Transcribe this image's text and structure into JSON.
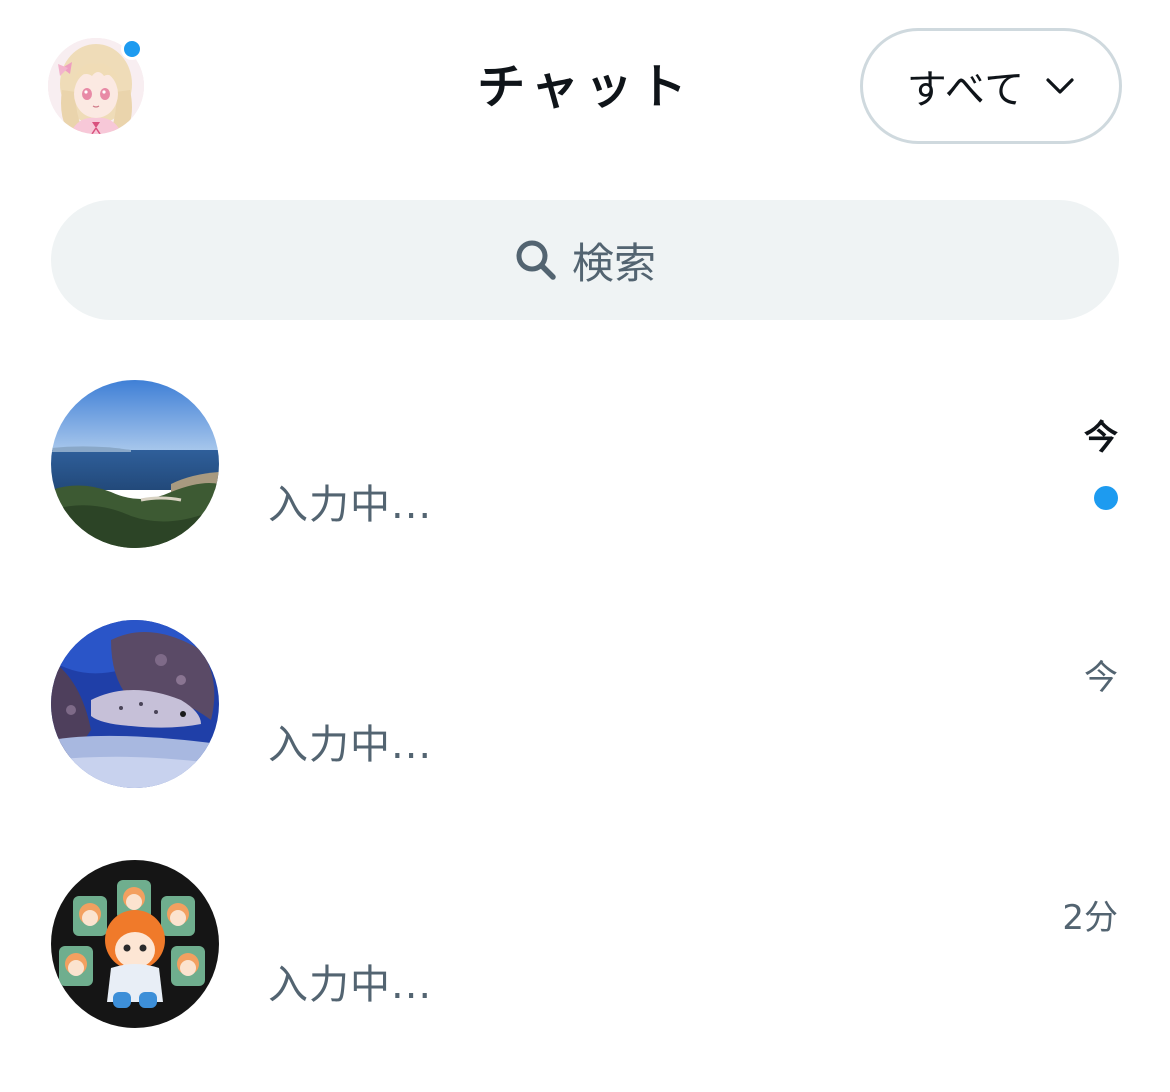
{
  "header": {
    "title": "チャット",
    "filter_label": "すべて",
    "profile_avatar": "anime-girl-avatar",
    "has_notification": true
  },
  "search": {
    "placeholder": "検索",
    "icon": "search-icon"
  },
  "conversations": [
    {
      "preview": "入力中...",
      "time": "今",
      "unread": true,
      "avatar": "coastal-landscape-avatar"
    },
    {
      "preview": "入力中...",
      "time": "今",
      "unread": false,
      "avatar": "moray-eel-aquarium-avatar"
    },
    {
      "preview": "入力中...",
      "time": "2分",
      "unread": false,
      "avatar": "plush-dolls-avatar"
    }
  ],
  "colors": {
    "accent": "#1d9bf0",
    "primary_text": "#0f1419",
    "secondary_text": "#536471",
    "search_bg": "#eff3f4",
    "border": "#cfd9de"
  }
}
